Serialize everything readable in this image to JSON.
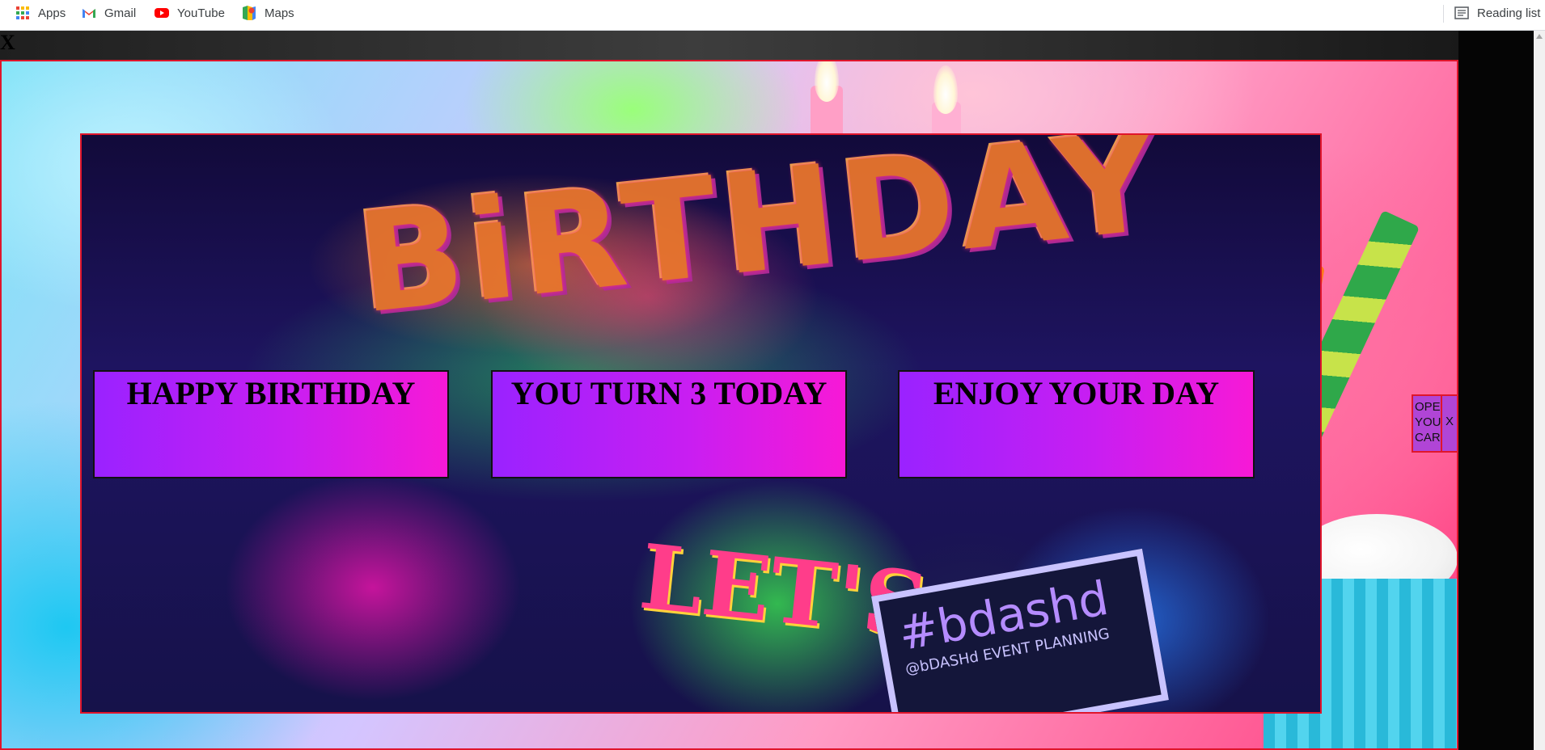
{
  "bookmarks": {
    "apps": {
      "label": "Apps",
      "icon": "apps-grid-icon"
    },
    "gmail": {
      "label": "Gmail",
      "icon": "gmail-icon"
    },
    "youtube": {
      "label": "YouTube",
      "icon": "youtube-icon"
    },
    "maps": {
      "label": "Maps",
      "icon": "maps-icon"
    },
    "reading_list": {
      "label": "Reading list",
      "icon": "reading-list-icon"
    }
  },
  "page": {
    "close_label": "X"
  },
  "messages": [
    {
      "text": "HAPPY BIRTHDAY"
    },
    {
      "text": "YOU TURN 3 TODAY"
    },
    {
      "text": "ENJOY YOUR DAY"
    }
  ],
  "side_widget": {
    "open_label": "OPE\nYOU\nCAR",
    "close_label": "X"
  },
  "photo": {
    "graffiti_text": "BiRTHDAY",
    "party_text": "LET'S",
    "chalkboard_text": "#bdashd",
    "chalkboard_sub": "@bDASHd  EVENT PLANNING"
  },
  "colors": {
    "accent_border": "#e0152b",
    "message_gradient_start": "#9a22ff",
    "message_gradient_end": "#f719d6"
  }
}
